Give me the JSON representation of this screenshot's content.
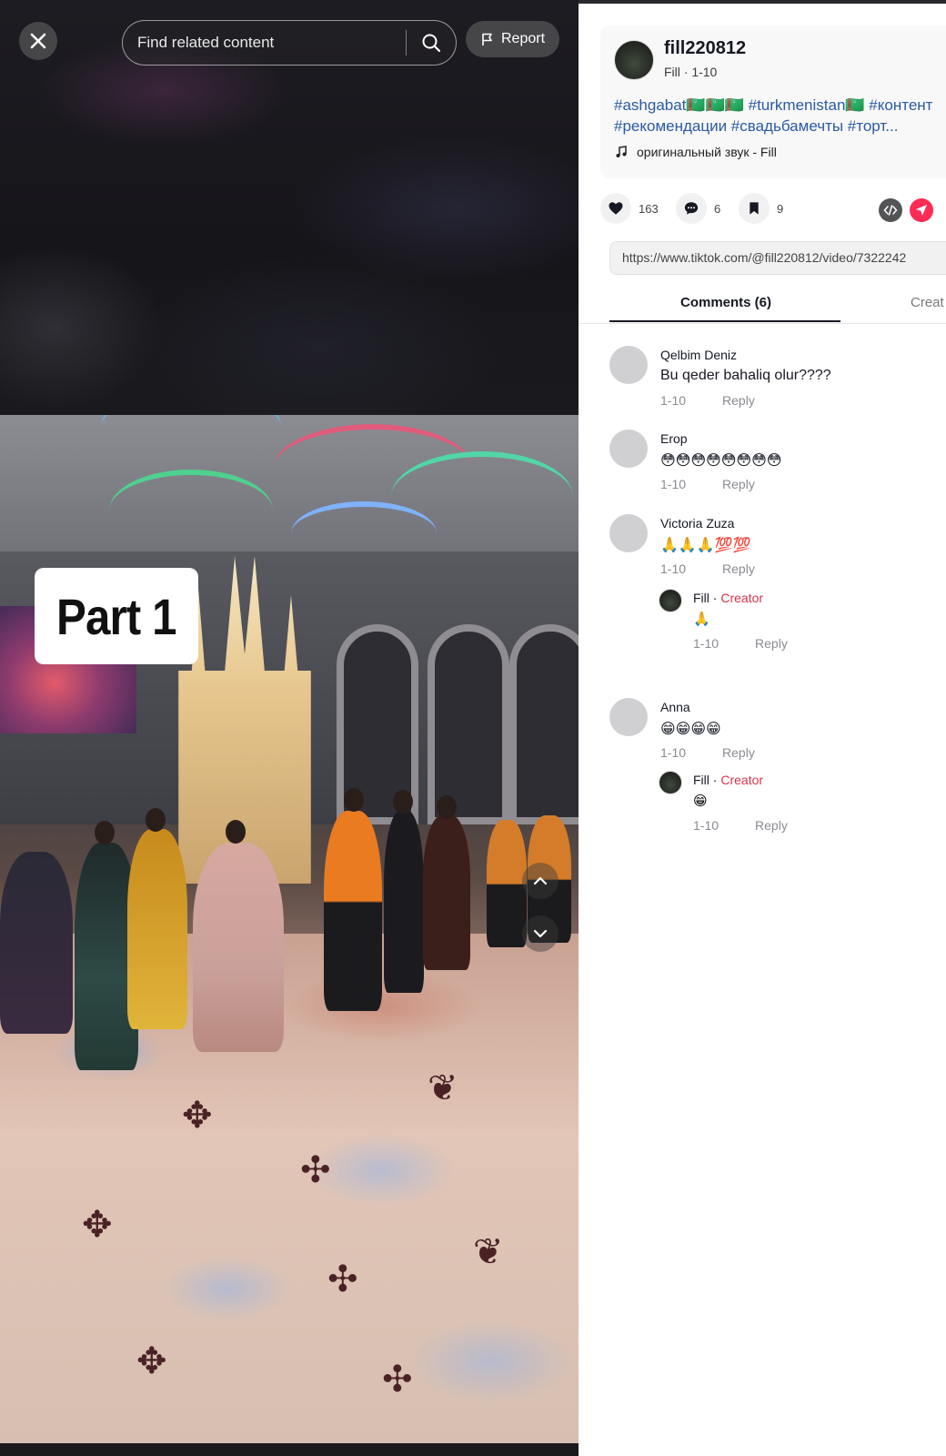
{
  "search": {
    "placeholder": "Find related content"
  },
  "report": {
    "label": "Report"
  },
  "video": {
    "overlay_text": "Part 1"
  },
  "post": {
    "username": "fill220812",
    "subline": "Fill · 1-10",
    "hashtags_line1": "#ashgabat🇹🇲🇹🇲🇹🇲 #turkmenistan🇹🇲 #контент",
    "hashtags_line2": "#рекомендации #свадьбамечты #торт...",
    "sound": "оригинальный звук - Fill"
  },
  "stats": {
    "likes": "163",
    "comments": "6",
    "saves": "9"
  },
  "url": "https://www.tiktok.com/@fill220812/video/7322242",
  "tabs": {
    "comments": "Comments (6)",
    "creator": "Creat"
  },
  "comments": [
    {
      "name": "Qelbim Deniz",
      "text": "Bu qeder bahaliq olur????",
      "date": "1-10",
      "reply": "Reply"
    },
    {
      "name": "Erop",
      "text": "😳😳😳😳😳😳😳😳",
      "date": "1-10",
      "reply": "Reply"
    },
    {
      "name": "Victoria Zuza",
      "text": "🙏🙏🙏💯💯",
      "date": "1-10",
      "reply": "Reply",
      "reply_item": {
        "name": "Fill",
        "creator": "Creator",
        "text": "🙏",
        "date": "1-10",
        "reply": "Reply"
      }
    },
    {
      "name": "Anna",
      "text": "😁😁😁😁",
      "date": "1-10",
      "reply": "Reply",
      "reply_item": {
        "name": "Fill",
        "creator": "Creator",
        "text": "😁",
        "date": "1-10",
        "reply": "Reply"
      }
    }
  ],
  "colors": {
    "accent": "#fe2c55",
    "creator": "#d9324b",
    "hashtag": "#2b5aa3"
  }
}
